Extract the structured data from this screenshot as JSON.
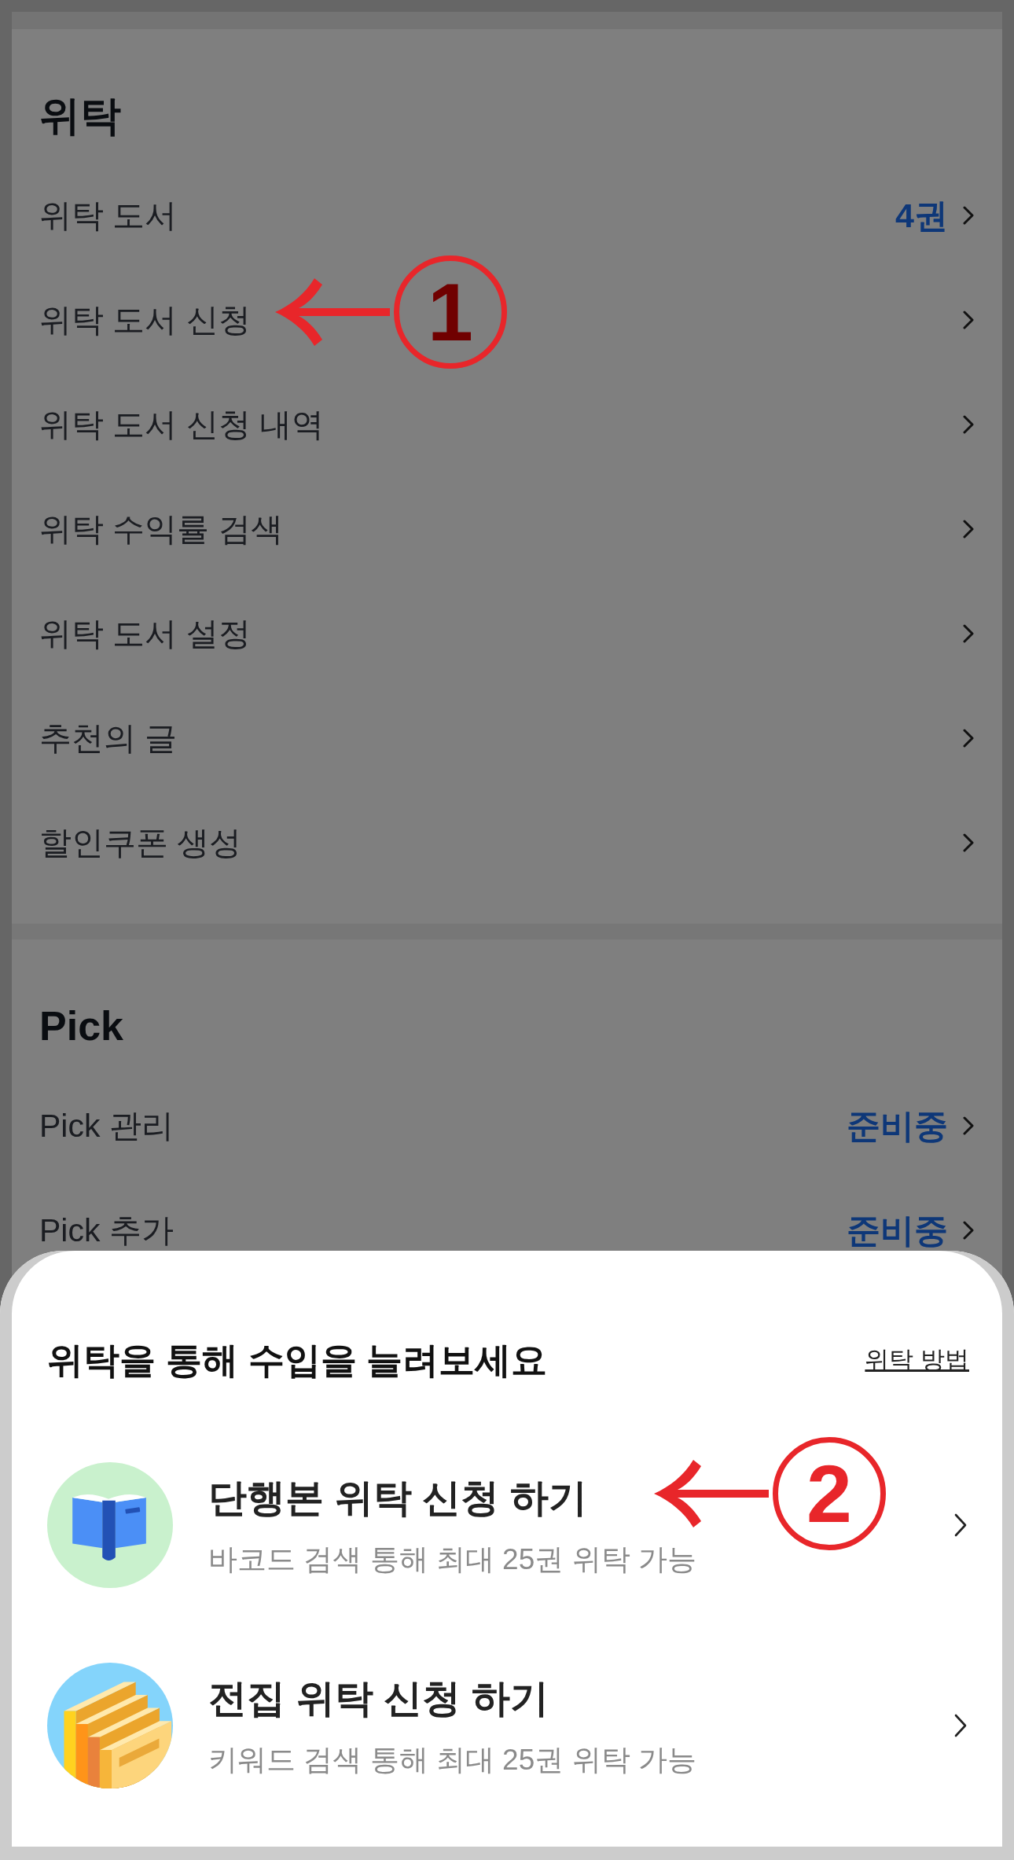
{
  "sections": [
    {
      "title": "위탁",
      "items": [
        {
          "label": "위탁 도서",
          "value": "4권"
        },
        {
          "label": "위탁 도서 신청",
          "annotation": "1"
        },
        {
          "label": "위탁 도서 신청 내역"
        },
        {
          "label": "위탁 수익률 검색"
        },
        {
          "label": "위탁 도서 설정"
        },
        {
          "label": "추천의 글"
        },
        {
          "label": "할인쿠폰 생성"
        }
      ]
    },
    {
      "title": "Pick",
      "items": [
        {
          "label": "Pick 관리",
          "value": "준비중"
        },
        {
          "label": "Pick 추가",
          "value": "준비중"
        }
      ]
    }
  ],
  "bottom_sheet": {
    "title": "위탁을 통해 수입을 늘려보세요",
    "link": "위탁 방법",
    "options": [
      {
        "kind": "single",
        "title": "단행본 위탁 신청 하기",
        "subtitle": "바코드 검색 통해 최대 25권 위탁 가능",
        "annotation": "2"
      },
      {
        "kind": "set",
        "title": "전집 위탁 신청 하기",
        "subtitle": "키워드 검색 통해 최대 25권 위탁 가능"
      }
    ]
  }
}
